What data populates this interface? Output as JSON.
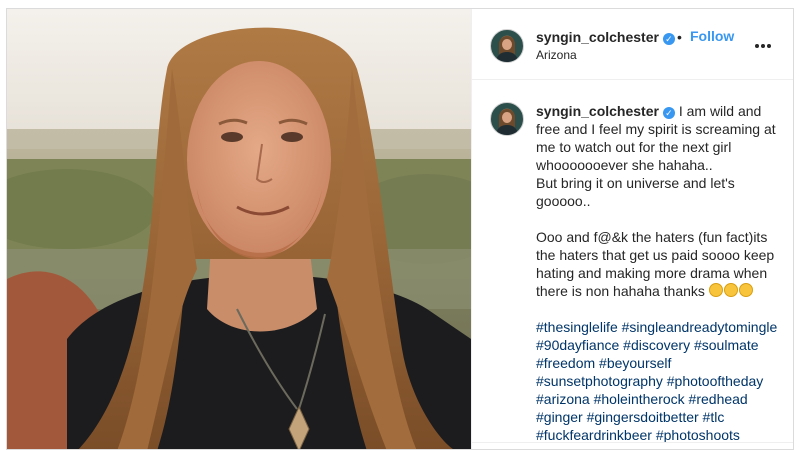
{
  "post": {
    "username": "syngin_colchester",
    "verified_icon": "verified-badge-icon",
    "separator": "•",
    "follow_label": "Follow",
    "location": "Arizona",
    "more_icon": "more-options-icon",
    "caption_username": "syngin_colchester",
    "caption_lines": [
      "I am wild and",
      "free and I feel my spirit is screaming at",
      "me to watch out for the next girl",
      "whooooooever she hahaha..",
      "But bring it on universe and let's",
      "gooooo.."
    ],
    "caption_lines_2": [
      "Ooo and f@&k the haters (fun fact)its",
      "the haters that get us paid soooo keep",
      "hating and making more drama when",
      "there is non hahaha thanks"
    ],
    "emoji_icons": [
      "face-with-rolling-eyes-emoji",
      "grimacing-face-emoji",
      "winking-tongue-emoji"
    ],
    "hashtag_lines": [
      "#thesinglelife #singleandreadytomingle",
      "#90dayfiance #discovery #soulmate",
      "#freedom #beyourself",
      "#sunsetphotography #photooftheday",
      "#arizona #holeintherock #redhead",
      "#ginger #gingersdoitbetter #tlc",
      "#fuckfeardrinkbeer #photoshoots"
    ]
  },
  "colors": {
    "link_blue": "#3897f0",
    "hashtag_blue": "#003569",
    "text": "#262626"
  }
}
